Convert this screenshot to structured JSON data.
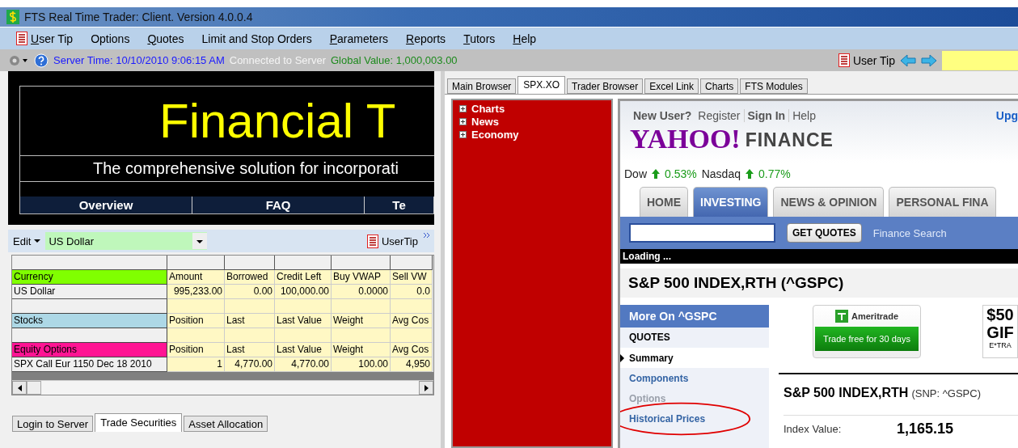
{
  "window": {
    "title": "FTS Real Time Trader: Client. Version 4.0.0.4"
  },
  "menu": [
    {
      "label": "User Tip",
      "kind": "tip",
      "mnemonic": true
    },
    {
      "label": "Options",
      "kind": "item",
      "mnemonic": false
    },
    {
      "label": "Quotes",
      "kind": "item",
      "mnemonic": true
    },
    {
      "label": "Limit and Stop Orders",
      "kind": "item",
      "mnemonic": false
    },
    {
      "label": "Parameters",
      "kind": "item",
      "mnemonic": true
    },
    {
      "label": "Reports",
      "kind": "item",
      "mnemonic": true
    },
    {
      "label": "Tutors",
      "kind": "item",
      "mnemonic": true
    },
    {
      "label": "Help",
      "kind": "item",
      "mnemonic": true
    }
  ],
  "toolbar": {
    "server_time": "Server Time: 10/10/2010 9:06:15 AM",
    "connection": "Connected to Server",
    "global_value": "Global Value: 1,000,003.00",
    "tip": "User Tip"
  },
  "banner": {
    "title": "Financial T",
    "subtitle": "The comprehensive solution for incorporati",
    "nav": [
      "Overview",
      "FAQ",
      "Te"
    ]
  },
  "portfolio": {
    "edit": "Edit",
    "currency": "US Dollar",
    "tip": "UserTip",
    "rows": [
      {
        "kind": "section",
        "label": "Currency",
        "color": "#80ff00",
        "cells": [
          "Amount",
          "Borrowed",
          "Credit Left",
          "Buy VWAP",
          "Sell VW"
        ]
      },
      {
        "kind": "data",
        "label": "US Dollar",
        "cells": [
          "995,233.00",
          "0.00",
          "100,000.00",
          "0.0000",
          "0.0"
        ]
      },
      {
        "kind": "spacer"
      },
      {
        "kind": "section",
        "label": "Stocks",
        "color": "#add8e6",
        "cells": [
          "Position",
          "Last",
          "Last Value",
          "Weight",
          "Avg Cos"
        ]
      },
      {
        "kind": "spacer"
      },
      {
        "kind": "section",
        "label": "Equity Options",
        "color": "#ff1493",
        "cells": [
          "Position",
          "Last",
          "Last Value",
          "Weight",
          "Avg Cos"
        ]
      },
      {
        "kind": "data",
        "label": "SPX Call Eur 1150 Dec 18 2010",
        "cells": [
          "1",
          "4,770.00",
          "4,770.00",
          "100.00",
          "4,950"
        ]
      }
    ]
  },
  "bottom_tabs": [
    {
      "label": "Login to Server",
      "selected": false
    },
    {
      "label": "Trade Securities",
      "selected": true
    },
    {
      "label": "Asset Allocation",
      "selected": false
    }
  ],
  "browser_tabs": [
    {
      "label": "Main Browser",
      "selected": false
    },
    {
      "label": "SPX.XO",
      "selected": true
    },
    {
      "label": "Trader Browser",
      "selected": false
    },
    {
      "label": "Excel Link",
      "selected": false
    },
    {
      "label": "Charts",
      "selected": false
    },
    {
      "label": "FTS Modules",
      "selected": false
    }
  ],
  "tree": [
    {
      "label": "Charts",
      "expanded": false
    },
    {
      "label": "News",
      "expanded": false
    },
    {
      "label": "Economy",
      "expanded": false
    }
  ],
  "web": {
    "top_links": [
      {
        "label": "New User?",
        "bold": true
      },
      {
        "label": "Register",
        "bold": false
      },
      {
        "label": "Sign In",
        "bold": true
      },
      {
        "label": "Help",
        "bold": false
      }
    ],
    "upgrade": "Upg",
    "logo": "YAHOO!",
    "logo_suffix": "FINANCE",
    "markets": [
      {
        "name": "Dow",
        "change": "0.53%"
      },
      {
        "name": "Nasdaq",
        "change": "0.77%"
      }
    ],
    "nav": [
      {
        "label": "HOME",
        "selected": false
      },
      {
        "label": "INVESTING",
        "selected": true
      },
      {
        "label": "NEWS & OPINION",
        "selected": false
      },
      {
        "label": "PERSONAL FINA",
        "selected": false
      }
    ],
    "search_button": "GET QUOTES",
    "search_link": "Finance Search",
    "loading": "Loading ...",
    "heading": "S&P 500 INDEX,RTH (^GSPC)",
    "side_title": "More On ^GSPC",
    "side_section": "QUOTES",
    "side_items": [
      {
        "label": "Summary",
        "selected": true,
        "disabled": false,
        "circled": false
      },
      {
        "label": "Components",
        "selected": false,
        "disabled": false,
        "circled": false
      },
      {
        "label": "Options",
        "selected": false,
        "disabled": true,
        "circled": false
      },
      {
        "label": "Historical Prices",
        "selected": false,
        "disabled": false,
        "circled": true
      }
    ],
    "ad": {
      "brand": "Ameritrade",
      "offer": "Trade free for 30 days"
    },
    "ad2": {
      "amount": "$50",
      "word": "GIF",
      "small": "E*TRA"
    },
    "quote_name": "S&P 500 INDEX,RTH",
    "quote_symbol": "(SNP: ^GSPC)",
    "quote_label": "Index Value:",
    "quote_value": "1,165.15"
  }
}
